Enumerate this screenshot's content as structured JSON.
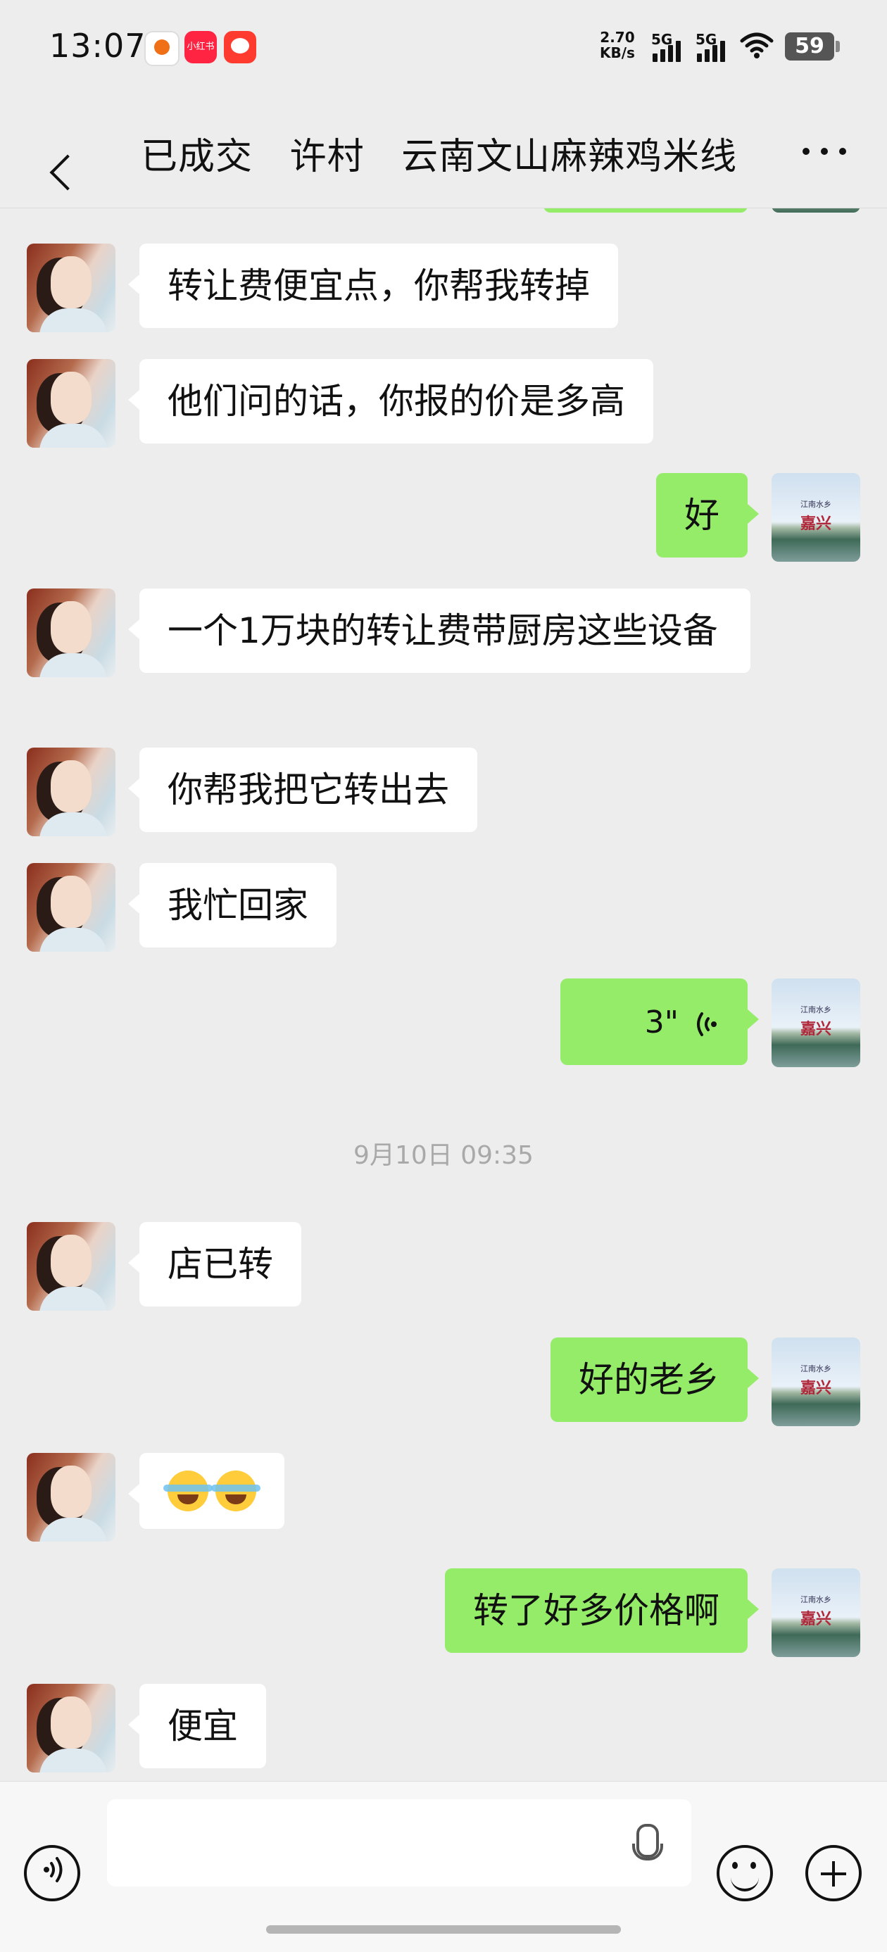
{
  "status_bar": {
    "time": "13:07",
    "app_icon_2_text": "小红书",
    "net_speed_value": "2.70",
    "net_speed_unit": "KB/s",
    "signal_1_label": "5G",
    "signal_2_label": "5G",
    "battery": "59"
  },
  "header": {
    "title": "已成交   许村   云南文山麻辣鸡米线"
  },
  "messages": [
    {
      "side": "left",
      "text": "转让费便宜点，你帮我转掉"
    },
    {
      "side": "left",
      "text": "他们问的话，你报的价是多高"
    },
    {
      "side": "right",
      "text": "好"
    },
    {
      "side": "left",
      "text": "一个1万块的转让费带厨房这些设备"
    },
    {
      "side": "left",
      "text": "你帮我把它转出去"
    },
    {
      "side": "left",
      "text": "我忙回家"
    },
    {
      "side": "right",
      "type": "voice",
      "duration": "3\""
    },
    {
      "side": "left",
      "text": "店已转"
    },
    {
      "side": "right",
      "text": "好的老乡"
    },
    {
      "side": "left",
      "type": "emoji",
      "emojis": [
        "cry-laugh-emoji",
        "cry-laugh-emoji"
      ]
    },
    {
      "side": "right",
      "text": "转了好多价格啊"
    },
    {
      "side": "left",
      "text": "便宜"
    }
  ],
  "timestamp": "9月10日 09:35",
  "self_avatar": {
    "small_text": "江南水乡",
    "big_text": "嘉兴"
  },
  "input_bar": {
    "placeholder": "",
    "icons": [
      "voice-mode-icon",
      "microphone-icon",
      "emoji-icon",
      "plus-icon"
    ]
  }
}
